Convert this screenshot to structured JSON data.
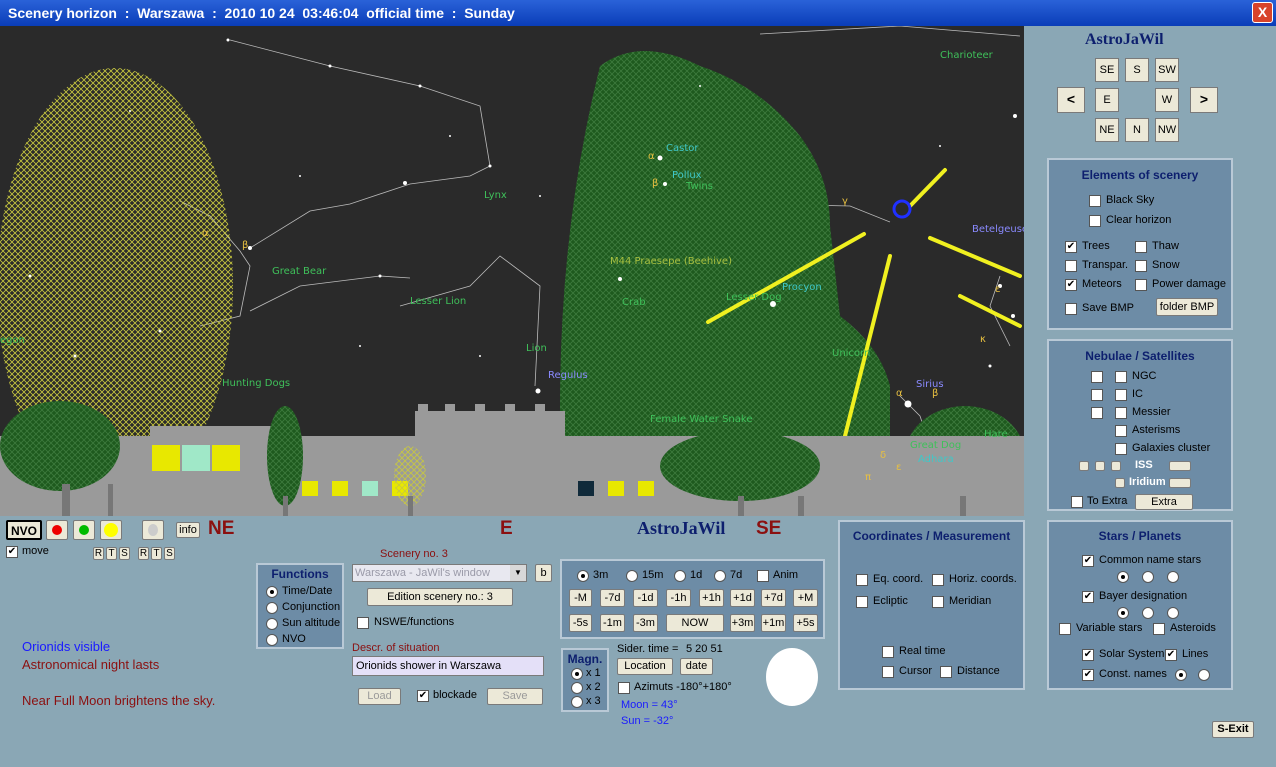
{
  "window": {
    "title": "Scenery horizon  :  Warszawa  :  2010 10 24  03:46:04  official time  :  Sunday",
    "close": "X"
  },
  "sky": {
    "constellations": [
      "Charioteer",
      "Lynx",
      "Great Bear",
      "Lesser Lion",
      "Lion",
      "Hunting Dogs",
      "Castor",
      "Pollux",
      "Twins",
      "M44 Praesepe (Beehive)",
      "Crab",
      "Lesser Dog",
      "Procyon",
      "Unicorn",
      "Female Water Snake",
      "Betelgeuse",
      "Sirius",
      "Great Dog",
      "Adhara",
      "Hare",
      "Regulus",
      "egon"
    ],
    "greek": [
      "α",
      "β",
      "γ",
      "β",
      "α",
      "ε",
      "κ",
      "α",
      "β",
      "δ",
      "ε",
      "π"
    ]
  },
  "nav": {
    "title": "AstroJaWil",
    "row1": [
      "SE",
      "S",
      "SW"
    ],
    "row2": [
      "<",
      "E",
      "W",
      ">"
    ],
    "row3": [
      "NE",
      "N",
      "NW"
    ]
  },
  "elements": {
    "title": "Elements of scenery",
    "black_sky": "Black Sky",
    "clear_horizon": "Clear horizon",
    "trees": "Trees",
    "thaw": "Thaw",
    "transpar": "Transpar.",
    "snow": "Snow",
    "meteors": "Meteors",
    "power": "Power damage",
    "save_bmp": "Save BMP",
    "folder_bmp": "folder BMP"
  },
  "nebulae": {
    "title": "Nebulae / Satellites",
    "ngc": "NGC",
    "ic": "IC",
    "messier": "Messier",
    "asterisms": "Asterisms",
    "galaxies": "Galaxies cluster",
    "iss": "ISS",
    "iridium": "Iridium",
    "to_extra": "To Extra",
    "extra": "Extra"
  },
  "bottom": {
    "nvo": "NVO",
    "info": "info",
    "move": "move",
    "rts": [
      "R",
      "T",
      "S",
      "R",
      "T",
      "S"
    ],
    "dir_left": "NE",
    "dir_mid": "E",
    "brand": "AstroJaWil",
    "dir_right": "SE"
  },
  "functions": {
    "title": "Functions",
    "items": [
      "Time/Date",
      "Conjunction",
      "Sun altitude",
      "NVO"
    ]
  },
  "scenery": {
    "label": "Scenery no. 3",
    "select": "Warszawa - JaWil's window",
    "b": "b",
    "edit": "Edition scenery no.: 3",
    "nswe": "NSWE/functions",
    "descr_label": "Descr. of situation",
    "descr": "Orionids shower in Warszawa",
    "load": "Load",
    "blockade": "blockade",
    "save": "Save"
  },
  "time": {
    "steps": [
      "3m",
      "15m",
      "1d",
      "7d"
    ],
    "anim": "Anim",
    "row1": [
      "-M",
      "-7d",
      "-1d",
      "-1h",
      "+1h",
      "+1d",
      "+7d",
      "+M"
    ],
    "row2": [
      "-5s",
      "-1m",
      "-3m",
      "NOW",
      "+3m",
      "+1m",
      "+5s"
    ]
  },
  "magn": {
    "title": "Magn.",
    "items": [
      "x 1",
      "x 2",
      "x 3"
    ]
  },
  "sider": {
    "label": "Sider. time =",
    "value": "5 20 51",
    "location": "Location",
    "date": "date",
    "azimuts": "Azimuts -180°+180°",
    "moon": "Moon = 43°",
    "sun": "Sun = -32°"
  },
  "messages": {
    "m1": "Orionids visible",
    "m2": "Astronomical night lasts",
    "m3": "Near Full Moon brightens the sky."
  },
  "coords": {
    "title": "Coordinates / Measurement",
    "eq": "Eq. coord.",
    "horiz": "Horiz. coords.",
    "ecliptic": "Ecliptic",
    "meridian": "Meridian",
    "realtime": "Real time",
    "cursor": "Cursor",
    "distance": "Distance"
  },
  "stars": {
    "title": "Stars / Planets",
    "common": "Common name stars",
    "bayer": "Bayer designation",
    "variable": "Variable stars",
    "asteroids": "Asteroids",
    "solar": "Solar System",
    "lines": "Lines",
    "const": "Const. names"
  },
  "exit": "S-Exit",
  "colors": {
    "sky": "#2a2a2a",
    "panel": "#6d8ca6",
    "bg": "#8aa7b5",
    "title_bar": "#0a3db8"
  }
}
